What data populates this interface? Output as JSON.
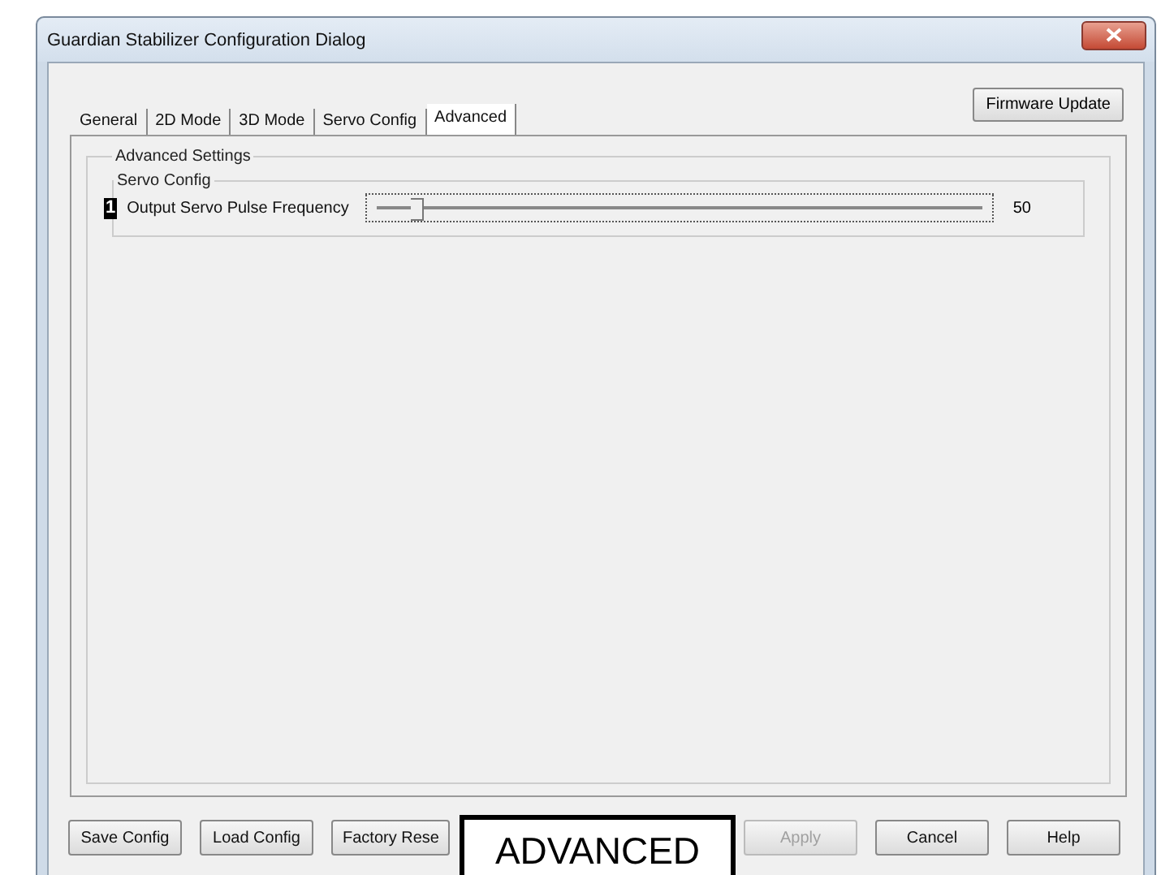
{
  "window": {
    "title": "Guardian Stabilizer Configuration Dialog"
  },
  "firmware_button": "Firmware Update",
  "tabs": [
    {
      "label": "General",
      "selected": false
    },
    {
      "label": "2D Mode",
      "selected": false
    },
    {
      "label": "3D Mode",
      "selected": false
    },
    {
      "label": "Servo Config",
      "selected": false
    },
    {
      "label": "Advanced",
      "selected": true
    }
  ],
  "group": {
    "title": "Advanced Settings",
    "subgroup": {
      "title": "Servo Config",
      "settings": [
        {
          "marker": "1",
          "label": "Output Servo Pulse Frequency",
          "level": 0.04,
          "reading": "50"
        }
      ]
    }
  },
  "left_buttons": [
    {
      "label": "Save Config",
      "disabled": false
    },
    {
      "label": "Load Config",
      "disabled": false
    },
    {
      "label": "Factory Rese",
      "disabled": false
    }
  ],
  "right_buttons": [
    {
      "label": "Apply",
      "disabled": true
    },
    {
      "label": "Cancel",
      "disabled": false
    },
    {
      "label": "Help",
      "disabled": false
    }
  ],
  "callout": "ADVANCED"
}
